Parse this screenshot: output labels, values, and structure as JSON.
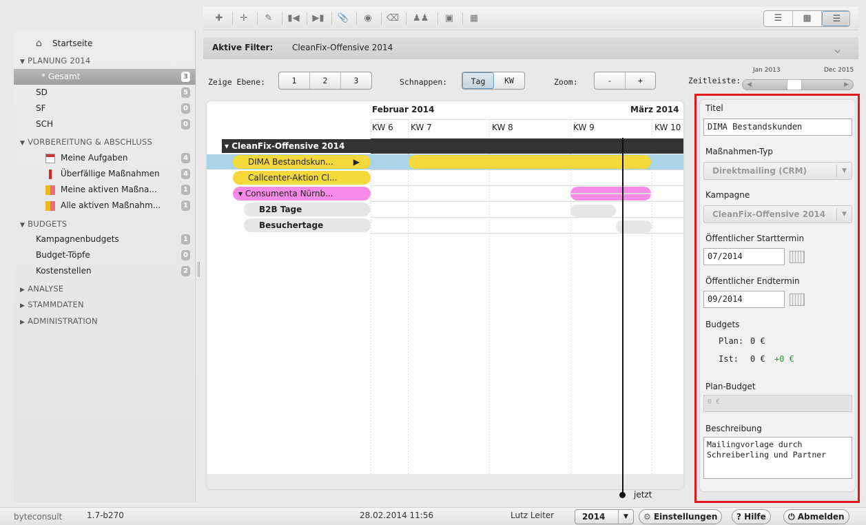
{
  "sidebar": {
    "home_label": "Startseite",
    "sections": [
      {
        "title": "PLANUNG 2014",
        "expanded": true
      },
      {
        "title": "VORBEREITUNG & ABSCHLUSS",
        "expanded": true
      },
      {
        "title": "BUDGETS",
        "expanded": true
      },
      {
        "title": "ANALYSE",
        "expanded": false
      },
      {
        "title": "STAMMDATEN",
        "expanded": false
      },
      {
        "title": "ADMINISTRATION",
        "expanded": false
      }
    ],
    "planung_items": [
      {
        "label": "* Gesamt",
        "badge": "3",
        "selected": true
      },
      {
        "label": "SD",
        "badge": "5"
      },
      {
        "label": "SF",
        "badge": "0"
      },
      {
        "label": "SCH",
        "badge": "0"
      }
    ],
    "vorbereitung_items": [
      {
        "label": "Meine Aufgaben",
        "badge": "4",
        "icon": "task-calendar-icon"
      },
      {
        "label": "Überfällige Maßnahmen",
        "badge": "4",
        "icon": "overdue-warning-icon"
      },
      {
        "label": "Meine aktiven Maßna...",
        "badge": "1",
        "icon": "active-measures-icon"
      },
      {
        "label": "Alle aktiven Maßnahm...",
        "badge": "1",
        "icon": "all-active-measures-icon"
      }
    ],
    "budget_items": [
      {
        "label": "Kampagnenbudgets",
        "badge": "1"
      },
      {
        "label": "Budget-Töpfe",
        "badge": "0"
      },
      {
        "label": "Kostenstellen",
        "badge": "2"
      }
    ]
  },
  "filter": {
    "label": "Aktive Filter:",
    "value": "CleanFix-Offensive 2014"
  },
  "controls": {
    "level_label": "Zeige Ebene:",
    "levels": [
      "1",
      "2",
      "3"
    ],
    "snap_label": "Schnappen:",
    "snap_options": [
      "Tag",
      "KW"
    ],
    "snap_active": "Tag",
    "zoom_label": "Zoom:",
    "zoom_minus": "-",
    "zoom_plus": "+",
    "timeline_label": "Zeitleiste:",
    "timeline_start": "Jan 2013",
    "timeline_end": "Dec 2015"
  },
  "gantt": {
    "months": [
      "Februar 2014",
      "März 2014"
    ],
    "weeks": [
      "KW 6",
      "KW 7",
      "KW 8",
      "KW 9",
      "KW 10"
    ],
    "rows": [
      {
        "label": "▾ CleanFix-Offensive 2014"
      },
      {
        "label": "DIMA Bestandskun..."
      },
      {
        "label": "Callcenter-Aktion Cl..."
      },
      {
        "label": "▾ Consumenta Nürnb..."
      },
      {
        "label": "B2B Tage"
      },
      {
        "label": "Besuchertage"
      }
    ],
    "now_label": "jetzt"
  },
  "detail": {
    "title_label": "Titel",
    "title_value": "DIMA Bestandskunden",
    "type_label": "Maßnahmen-Typ",
    "type_value": "Direktmailing (CRM)",
    "campaign_label": "Kampagne",
    "campaign_value": "CleanFix-Offensive 2014",
    "start_label": "Öffentlicher Starttermin",
    "start_value": "07/2014",
    "end_label": "Öffentlicher Endtermin",
    "end_value": "09/2014",
    "budgets_label": "Budgets",
    "plan_label": "Plan:",
    "plan_value": "0 €",
    "ist_label": "Ist:",
    "ist_value": "0 €",
    "ist_delta": "+0 €",
    "plan_budget_label": "Plan-Budget",
    "plan_budget_placeholder": "0 €",
    "description_label": "Beschreibung",
    "description_value": "Mailingvorlage durch Schreiberling und Partner"
  },
  "status": {
    "brand": "byteconsult",
    "version": "1.7-b270",
    "datetime": "28.02.2014 11:56",
    "user": "Lutz Leiter",
    "year": "2014",
    "settings_label": "Einstellungen",
    "help_label": "Hilfe",
    "logout_label": "Abmelden"
  },
  "colors": {
    "selection_blue": "#a9d3e6",
    "bar_yellow": "#f5d83a",
    "bar_pink": "#f58be6",
    "header_dark": "#333333",
    "highlight_red": "#e3161a",
    "delta_green": "#2a9b2a"
  }
}
